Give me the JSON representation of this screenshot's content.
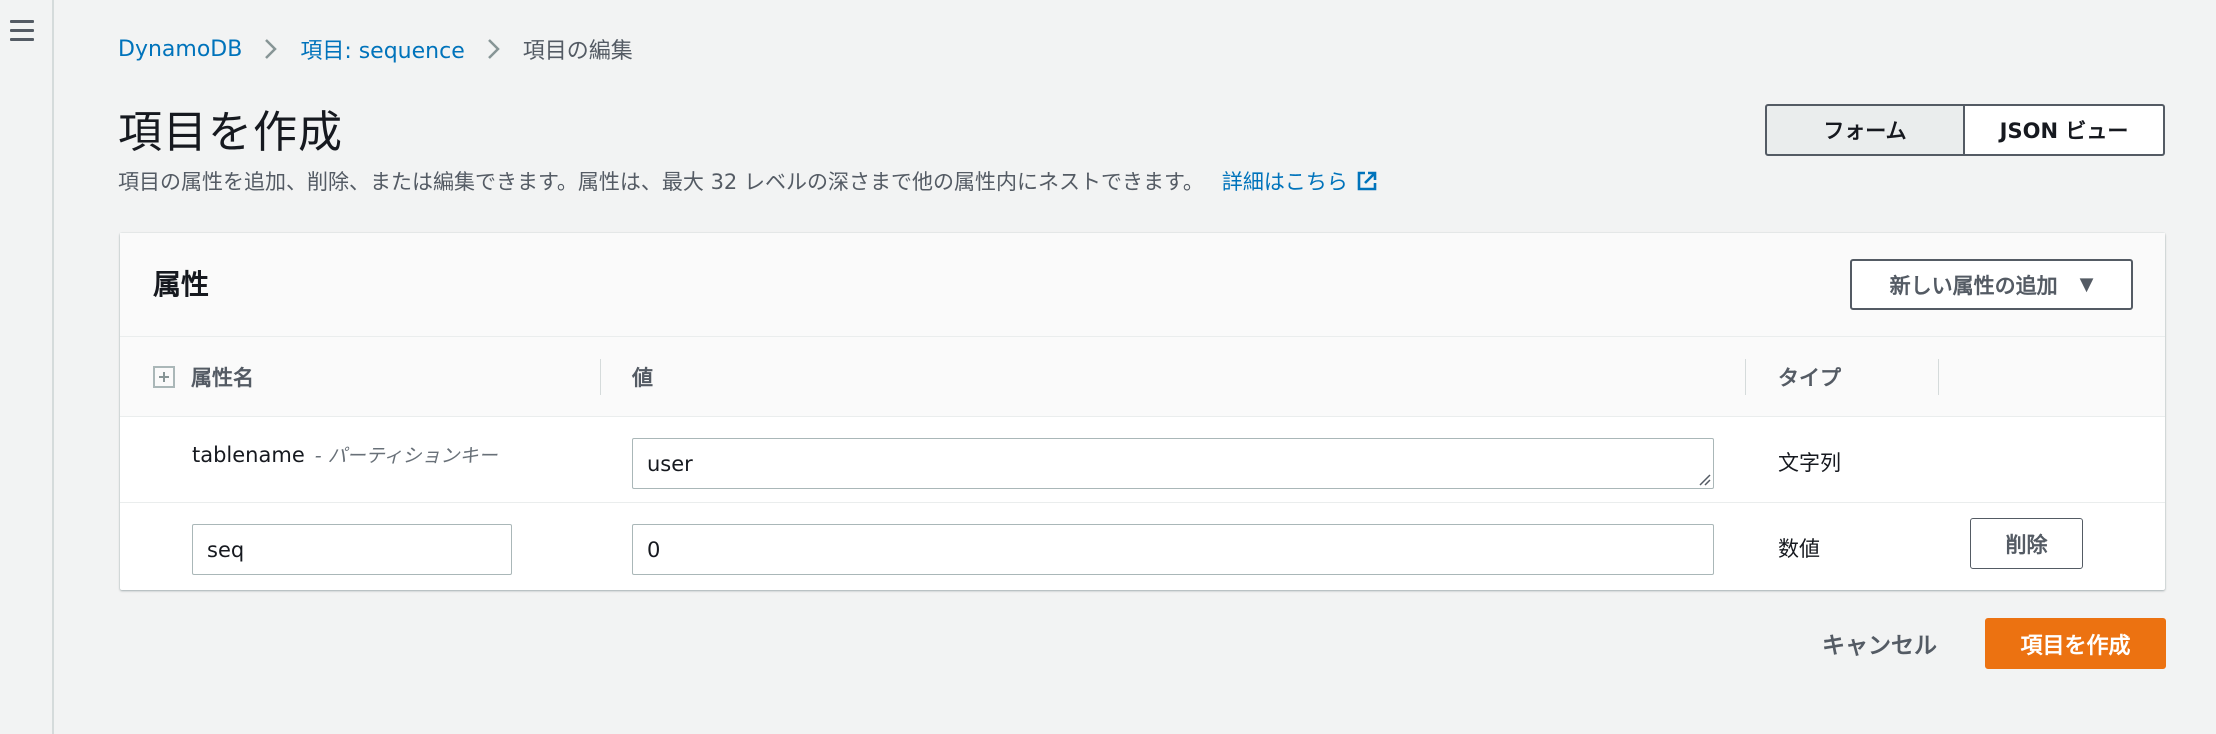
{
  "breadcrumb": {
    "root": "DynamoDB",
    "item": "項目: sequence",
    "current": "項目の編集"
  },
  "page": {
    "title": "項目を作成",
    "description": "項目の属性を追加、削除、または編集できます。属性は、最大 32 レベルの深さまで他の属性内にネストできます。",
    "learn_more": "詳細はこちら"
  },
  "view_toggle": {
    "form_label": "フォーム",
    "json_label": "JSON ビュー",
    "selected": "フォーム"
  },
  "attributes_panel": {
    "title": "属性",
    "add_button": "新しい属性の追加",
    "columns": {
      "name": "属性名",
      "value": "値",
      "type": "タイプ"
    },
    "rows": [
      {
        "name": "tablename",
        "key_label": "- パーティションキー",
        "value": "user",
        "type": "文字列"
      },
      {
        "name": "seq",
        "value": "0",
        "type": "数値",
        "delete_label": "削除"
      }
    ]
  },
  "footer": {
    "cancel": "キャンセル",
    "create": "項目を作成"
  },
  "colors": {
    "primary_button": "#ec7211",
    "link": "#0073bb",
    "background": "#f2f3f3"
  }
}
